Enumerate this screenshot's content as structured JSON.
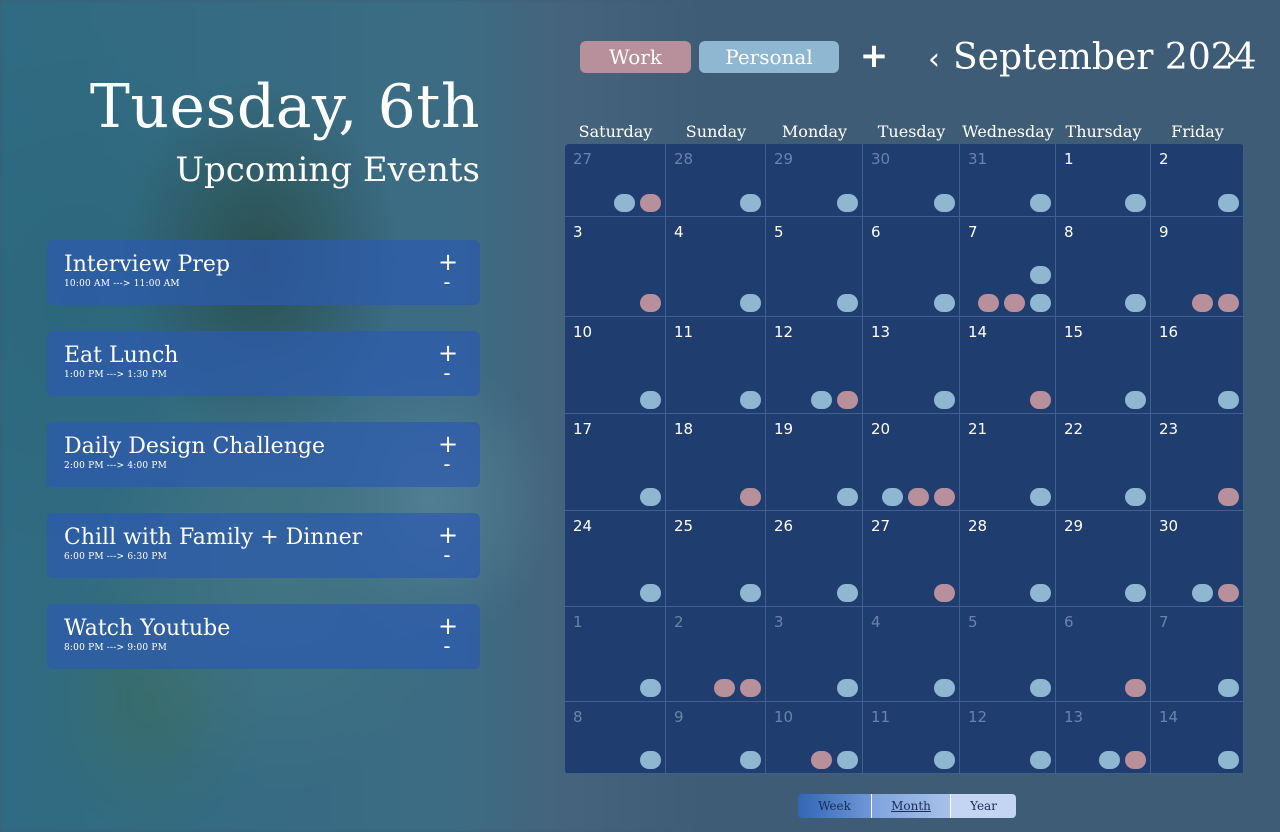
{
  "header": {
    "date_title": "Tuesday, 6th",
    "subtitle": "Upcoming Events"
  },
  "events": [
    {
      "title": "Interview Prep",
      "time": "10:00 AM ---> 11:00 AM",
      "add": "+",
      "remove": "-"
    },
    {
      "title": "Eat Lunch",
      "time": "1:00 PM ---> 1:30 PM",
      "add": "+",
      "remove": "-"
    },
    {
      "title": "Daily Design Challenge",
      "time": "2:00 PM ---> 4:00 PM",
      "add": "+",
      "remove": "-"
    },
    {
      "title": "Chill with Family + Dinner",
      "time": "6:00 PM ---> 6:30 PM",
      "add": "+",
      "remove": "-"
    },
    {
      "title": "Watch Youtube",
      "time": "8:00 PM ---> 9:00 PM",
      "add": "+",
      "remove": "-"
    }
  ],
  "toolbar": {
    "work_label": "Work",
    "personal_label": "Personal",
    "add_label": "+",
    "prev": "‹",
    "next": "›",
    "month_title": "September 2024"
  },
  "colors": {
    "work": "#b8909c",
    "personal": "#8fb7d2"
  },
  "calendar": {
    "weekdays": [
      "Saturday",
      "Sunday",
      "Monday",
      "Tuesday",
      "Wednesday",
      "Thursday",
      "Friday"
    ],
    "weeks": [
      [
        {
          "d": "27",
          "muted": true,
          "dots": [
            [
              "p"
            ],
            [
              "w"
            ]
          ]
        },
        {
          "d": "28",
          "muted": true,
          "dots": [
            [
              "p"
            ]
          ]
        },
        {
          "d": "29",
          "muted": true,
          "dots": [
            [
              "p"
            ]
          ]
        },
        {
          "d": "30",
          "muted": true,
          "dots": [
            [
              "p"
            ]
          ]
        },
        {
          "d": "31",
          "muted": true,
          "dots": [
            [
              "p"
            ]
          ]
        },
        {
          "d": "1",
          "dots": [
            [
              "p"
            ]
          ]
        },
        {
          "d": "2",
          "dots": []
        }
      ],
      [
        {
          "d": "3",
          "dots": [
            [
              "w"
            ]
          ]
        },
        {
          "d": "4",
          "dots": [
            [
              "p"
            ]
          ]
        },
        {
          "d": "5",
          "dots": []
        },
        {
          "d": "6",
          "dots": [
            [
              "p"
            ]
          ]
        },
        {
          "d": "7",
          "dots": [
            [
              "w"
            ],
            [
              "w"
            ],
            [
              "p",
              "p"
            ]
          ]
        },
        {
          "d": "8",
          "dots": []
        },
        {
          "d": "9",
          "dots": [
            [
              "w"
            ],
            [
              "w"
            ]
          ]
        }
      ],
      [
        {
          "d": "10",
          "dots": []
        },
        {
          "d": "11",
          "dots": []
        },
        {
          "d": "12",
          "dots": [
            [
              "p"
            ],
            [
              "w"
            ]
          ]
        },
        {
          "d": "13",
          "dots": []
        },
        {
          "d": "14",
          "dots": [
            [
              "w"
            ]
          ]
        },
        {
          "d": "15",
          "dots": [
            [
              "p"
            ]
          ]
        },
        {
          "d": "16",
          "dots": []
        }
      ],
      [
        {
          "d": "17",
          "dots": []
        },
        {
          "d": "18",
          "dots": [
            [
              "w"
            ]
          ]
        },
        {
          "d": "19",
          "dots": []
        },
        {
          "d": "20",
          "dots": [
            [
              "p"
            ],
            [
              "w"
            ],
            [
              "w"
            ]
          ]
        },
        {
          "d": "21",
          "dots": [
            [
              "p"
            ]
          ]
        },
        {
          "d": "22",
          "dots": []
        },
        {
          "d": "23",
          "dots": [
            [
              "w"
            ]
          ]
        }
      ],
      [
        {
          "d": "24",
          "dots": [
            [
              "p"
            ]
          ]
        },
        {
          "d": "25",
          "dots": []
        },
        {
          "d": "26",
          "dots": []
        },
        {
          "d": "27",
          "dots": [
            [
              "w"
            ]
          ]
        },
        {
          "d": "28",
          "dots": []
        },
        {
          "d": "29",
          "dots": []
        },
        {
          "d": "30",
          "dots": [
            [
              "p"
            ],
            [
              "w"
            ]
          ]
        }
      ],
      [
        {
          "d": "1",
          "muted": true,
          "dots": []
        },
        {
          "d": "2",
          "muted": true,
          "dots": [
            [
              "w"
            ],
            [
              "w"
            ]
          ]
        },
        {
          "d": "3",
          "muted": true,
          "dots": [
            [
              "p"
            ]
          ]
        },
        {
          "d": "4",
          "muted": true,
          "dots": []
        },
        {
          "d": "5",
          "muted": true,
          "dots": []
        },
        {
          "d": "6",
          "muted": true,
          "dots": [
            [
              "w"
            ]
          ]
        },
        {
          "d": "7",
          "muted": true,
          "dots": []
        }
      ],
      [
        {
          "d": "8",
          "muted": true,
          "dots": [
            [
              "p"
            ]
          ]
        },
        {
          "d": "9",
          "muted": true,
          "dots": [
            [
              "p"
            ]
          ]
        },
        {
          "d": "10",
          "muted": true,
          "dots": [
            [
              "w"
            ],
            [
              "p"
            ]
          ]
        },
        {
          "d": "11",
          "muted": true,
          "dots": [
            [
              "p"
            ]
          ]
        },
        {
          "d": "12",
          "muted": true,
          "dots": []
        },
        {
          "d": "13",
          "muted": true,
          "dots": [
            [
              "p"
            ],
            [
              "w"
            ]
          ]
        },
        {
          "d": "14",
          "muted": true,
          "dots": []
        }
      ]
    ]
  },
  "view_switch": {
    "week": "Week",
    "month": "Month",
    "year": "Year",
    "selected": "Month"
  }
}
